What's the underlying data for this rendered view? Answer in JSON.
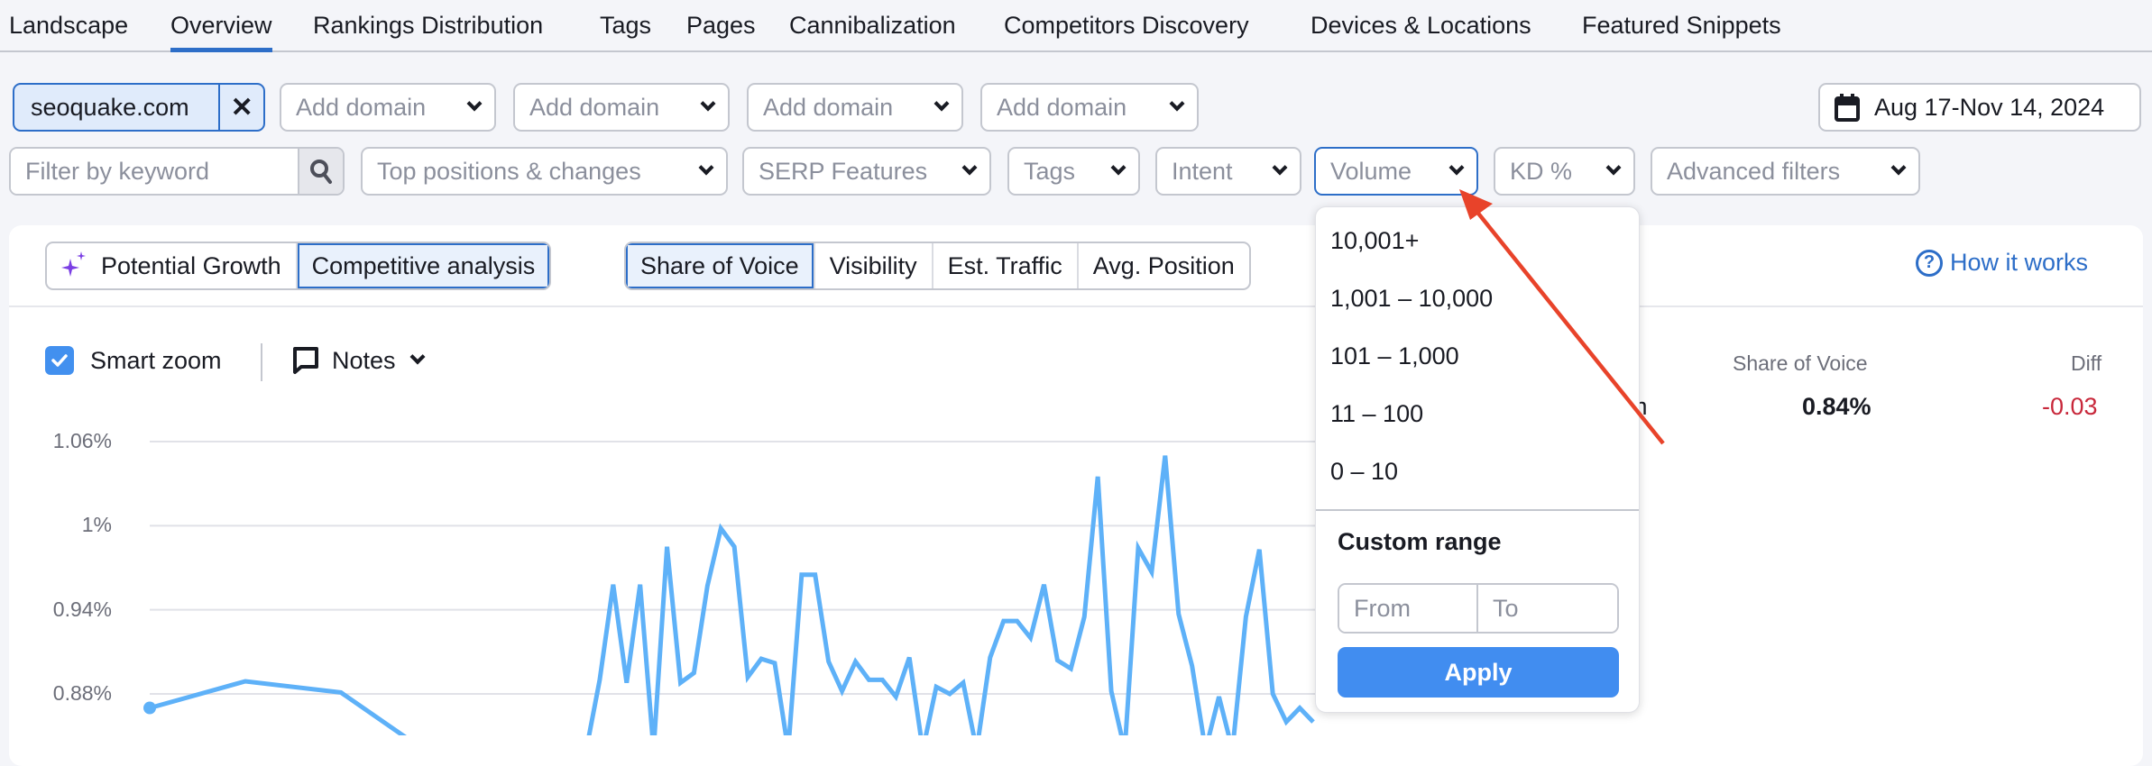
{
  "tabs": [
    {
      "label": "Landscape",
      "active": false
    },
    {
      "label": "Overview",
      "active": true
    },
    {
      "label": "Rankings Distribution",
      "active": false
    },
    {
      "label": "Tags",
      "active": false
    },
    {
      "label": "Pages",
      "active": false
    },
    {
      "label": "Cannibalization",
      "active": false
    },
    {
      "label": "Competitors Discovery",
      "active": false
    },
    {
      "label": "Devices & Locations",
      "active": false
    },
    {
      "label": "Featured Snippets",
      "active": false
    }
  ],
  "domains": {
    "selected": "seoquake.com",
    "remove_icon": "close-icon",
    "add_placeholders": [
      "Add domain",
      "Add domain",
      "Add domain",
      "Add domain"
    ]
  },
  "date_range": {
    "label": "Aug 17-Nov 14, 2024",
    "icon": "calendar-icon"
  },
  "filters": {
    "keyword_placeholder": "Filter by keyword",
    "search_icon": "search-icon",
    "dropdowns": [
      "Top positions & changes",
      "SERP Features",
      "Tags",
      "Intent",
      "Volume",
      "KD %",
      "Advanced filters"
    ],
    "active_dropdown": "Volume"
  },
  "analysis_modes": [
    {
      "label": "Potential Growth",
      "icon": "sparkle-icon",
      "selected": false
    },
    {
      "label": "Competitive analysis",
      "selected": true
    }
  ],
  "metrics": [
    {
      "label": "Share of Voice",
      "selected": true
    },
    {
      "label": "Visibility",
      "selected": false
    },
    {
      "label": "Est. Traffic",
      "selected": false
    },
    {
      "label": "Avg. Position",
      "selected": false
    }
  ],
  "how_it_works": "How it works",
  "chart_controls": {
    "smart_zoom_label": "Smart zoom",
    "smart_zoom_checked": true,
    "notes_label": "Notes"
  },
  "legend": {
    "col_metric": "Share of Voice",
    "col_diff": "Diff",
    "row_domain_fragment": "m",
    "row_value": "0.84%",
    "row_diff": "-0.03",
    "diff_color": "#c8283b"
  },
  "volume_dropdown": {
    "options": [
      "10,001+",
      "1,001 – 10,000",
      "101 – 1,000",
      "11 – 100",
      "0 – 10"
    ],
    "custom_range_title": "Custom range",
    "from_placeholder": "From",
    "to_placeholder": "To",
    "apply_label": "Apply"
  },
  "colors": {
    "accent": "#2d6ec8",
    "line": "#5eb1f8",
    "apply": "#418df0",
    "annotation_arrow": "#e8432a"
  },
  "chart_data": {
    "type": "line",
    "title": "",
    "xlabel": "",
    "ylabel": "Share of Voice",
    "y_ticks": [
      "1.06%",
      "1%",
      "0.94%",
      "0.88%"
    ],
    "y_tick_values": [
      1.06,
      1.0,
      0.94,
      0.88
    ],
    "ylim": [
      0.835,
      1.06
    ],
    "grid": true,
    "series": [
      {
        "name": "seoquake.com",
        "values": [
          0.87,
          0.889,
          0.881,
          0.84,
          0.83,
          0.84,
          0.89,
          0.958,
          0.888,
          0.958,
          0.84,
          0.985,
          0.888,
          0.895,
          0.957,
          0.998,
          0.985,
          0.892,
          0.905,
          0.902,
          0.84,
          0.965,
          0.965,
          0.903,
          0.882,
          0.903,
          0.89,
          0.89,
          0.878,
          0.906,
          0.84,
          0.885,
          0.88,
          0.888,
          0.84,
          0.906,
          0.932,
          0.932,
          0.92,
          0.958,
          0.904,
          0.898,
          0.935,
          1.035,
          0.882,
          0.84,
          0.984,
          0.967,
          1.05,
          0.937,
          0.9,
          0.84,
          0.878,
          0.84,
          0.935,
          0.983,
          0.88,
          0.86,
          0.87,
          0.86
        ]
      }
    ]
  }
}
